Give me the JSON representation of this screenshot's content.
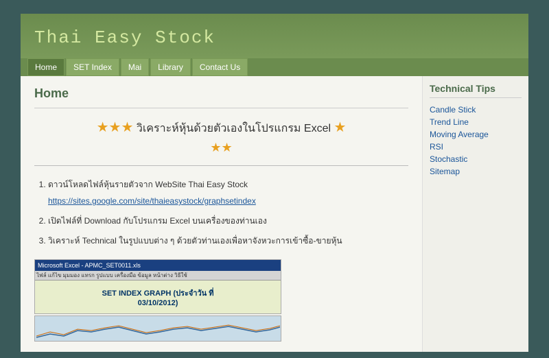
{
  "header": {
    "title": "Thai Easy Stock"
  },
  "navbar": {
    "items": [
      {
        "label": "Home",
        "active": true
      },
      {
        "label": "SET Index",
        "active": false
      },
      {
        "label": "Mai",
        "active": false
      },
      {
        "label": "Library",
        "active": false
      },
      {
        "label": "Contact Us",
        "active": false
      }
    ]
  },
  "main": {
    "page_title": "Home",
    "star_heading": "★★★ วิเคราะห์หุ้นด้วยตัวเองในโปรแกรม Excel ★",
    "sub_stars": "★★",
    "list_items": [
      {
        "text": "ดาวน์โหลดไฟล์หุ้นรายตัวจาก WebSite Thai Easy Stock",
        "link": "https://sites.google.com/site/thaieasystock/graphsetindex",
        "link_text": "https://sites.google.com/site/thaieasystock/graphsetindex"
      },
      {
        "text": "เปิดไฟล์ที่ Download กับโปรแกรม Excel บนเครื่องของท่านเอง"
      },
      {
        "text": "วิเคราะห์ Technical ในรูปแบบต่าง ๆ ด้วยตัวท่านเองเพื่อหาจังหวะการเข้าซื้อ-ขายหุ้น"
      }
    ],
    "screenshot_label": "SET INDEX GRAPH (ประจำวัน ที่ 03/10/2012)"
  },
  "sidebar": {
    "title": "Technical Tips",
    "links": [
      {
        "label": "Candle Stick"
      },
      {
        "label": "Trend Line"
      },
      {
        "label": "Moving Average"
      },
      {
        "label": "RSI"
      },
      {
        "label": "Stochastic"
      },
      {
        "label": "Sitemap"
      }
    ]
  }
}
